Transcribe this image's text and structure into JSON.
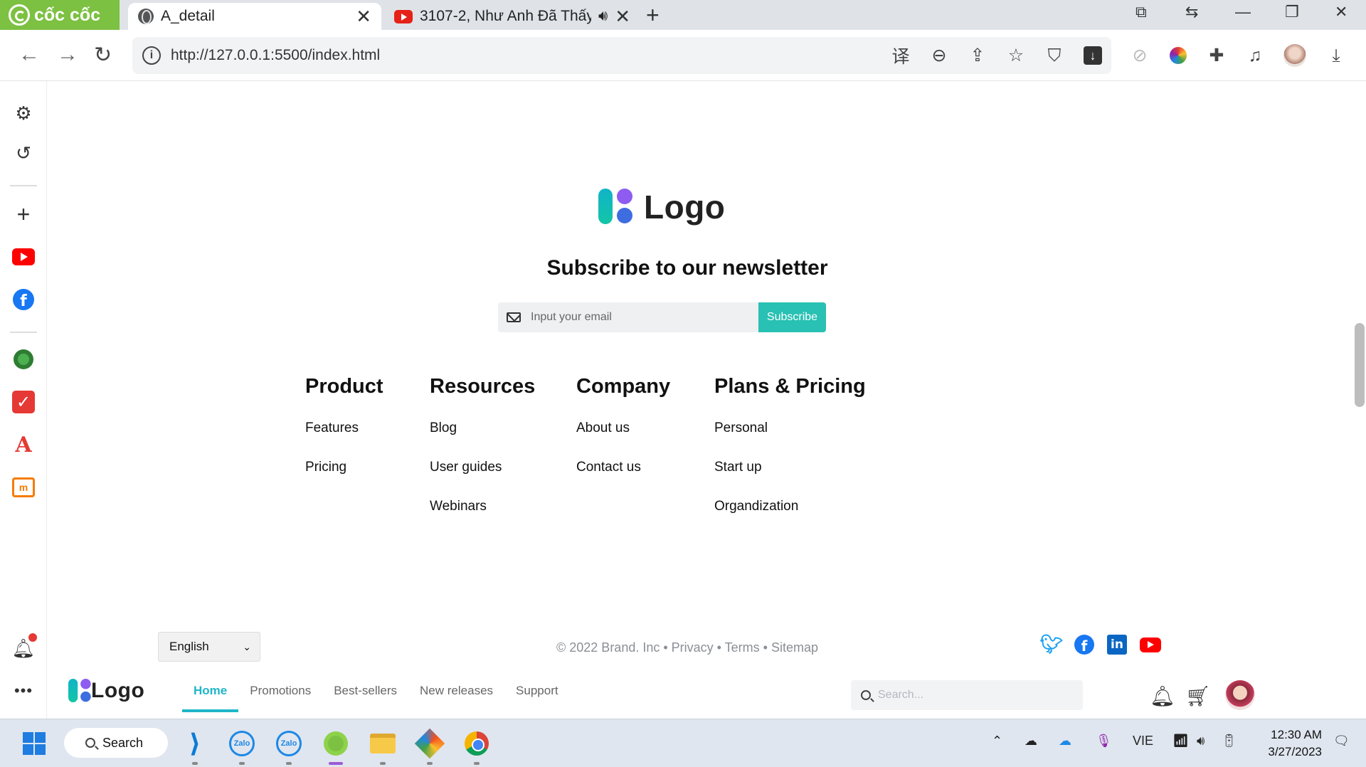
{
  "browser": {
    "brand": "cốc cốc",
    "tabs": [
      {
        "title": "A_detail",
        "active": true
      },
      {
        "title": "3107-2, Như Anh Đã Thấy",
        "active": false
      }
    ],
    "url": "http://127.0.0.1:5500/index.html"
  },
  "page": {
    "logo_text": "Logo",
    "newsletter": {
      "title": "Subscribe to our newsletter",
      "email_placeholder": "Input your email",
      "button": "Subscribe"
    },
    "columns": [
      {
        "heading": "Product",
        "links": [
          "Features",
          "Pricing"
        ]
      },
      {
        "heading": "Resources",
        "links": [
          "Blog",
          "User guides",
          "Webinars"
        ]
      },
      {
        "heading": "Company",
        "links": [
          "About us",
          "Contact us"
        ]
      },
      {
        "heading": "Plans & Pricing",
        "links": [
          "Personal",
          "Start up",
          "Organdization"
        ]
      }
    ],
    "language": "English",
    "copyright": "© 2022 Brand. Inc • Privacy • Terms • Sitemap",
    "socials": [
      "twitter-icon",
      "facebook-icon",
      "linkedin-icon",
      "youtube-icon"
    ],
    "header": {
      "logo_text": "Logo",
      "nav": [
        "Home",
        "Promotions",
        "Best-sellers",
        "New releases",
        "Support"
      ],
      "active_nav": "Home",
      "search_placeholder": "Search..."
    }
  },
  "taskbar": {
    "search_label": "Search",
    "language": "VIE",
    "time": "12:30 AM",
    "date": "3/27/2023"
  },
  "colors": {
    "accent": "#28c1b3",
    "nav_active": "#1fb6c8",
    "coccoc_green": "#7cc142"
  }
}
